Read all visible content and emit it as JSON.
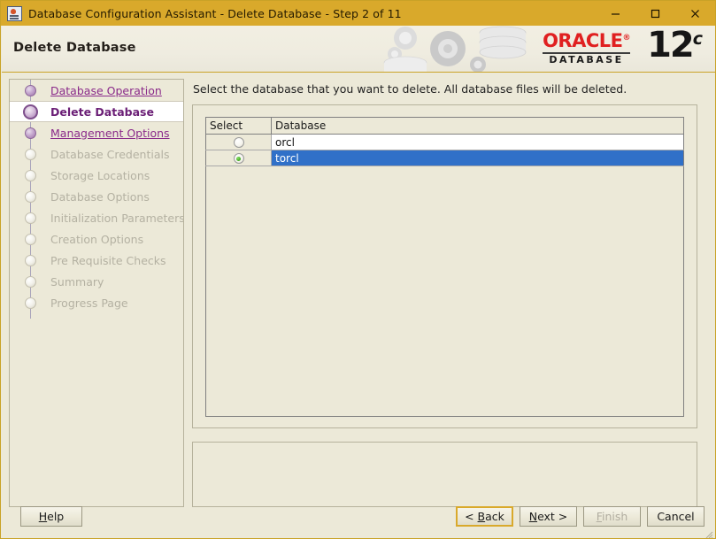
{
  "window": {
    "title": "Database Configuration Assistant - Delete Database - Step 2 of 11",
    "icon": "java-app-icon",
    "controls": {
      "minimize": "minimize-icon",
      "maximize": "maximize-icon",
      "close": "close-icon"
    }
  },
  "banner": {
    "title": "Delete Database",
    "brand": "ORACLE",
    "brand_sub": "DATABASE",
    "version": "12",
    "version_suffix": "c"
  },
  "sidebar": {
    "steps": [
      {
        "label": "Database Operation",
        "state": "done"
      },
      {
        "label": "Delete Database",
        "state": "current"
      },
      {
        "label": "Management Options",
        "state": "done"
      },
      {
        "label": "Database Credentials",
        "state": "todo"
      },
      {
        "label": "Storage Locations",
        "state": "todo"
      },
      {
        "label": "Database Options",
        "state": "todo"
      },
      {
        "label": "Initialization Parameters",
        "state": "todo"
      },
      {
        "label": "Creation Options",
        "state": "todo"
      },
      {
        "label": "Pre Requisite Checks",
        "state": "todo"
      },
      {
        "label": "Summary",
        "state": "todo"
      },
      {
        "label": "Progress Page",
        "state": "todo"
      }
    ]
  },
  "main": {
    "instruction": "Select the database that you want to delete. All database files will be deleted.",
    "table": {
      "columns": [
        "Select",
        "Database"
      ],
      "rows": [
        {
          "name": "orcl",
          "selected": false
        },
        {
          "name": "torcl",
          "selected": true
        }
      ]
    },
    "message": ""
  },
  "buttons": {
    "help": "Help",
    "back": "< Back",
    "next": "Next >",
    "finish": "Finish",
    "cancel": "Cancel"
  },
  "colors": {
    "titlebar": "#d9a92b",
    "window_bg": "#ece9d8",
    "selection_blue": "#3070c8",
    "oracle_red": "#e02020",
    "step_done": "#8a2a8a",
    "step_current": "#6b1f76",
    "step_todo": "#b4b1a2",
    "radio_green": "#3fa81e"
  }
}
